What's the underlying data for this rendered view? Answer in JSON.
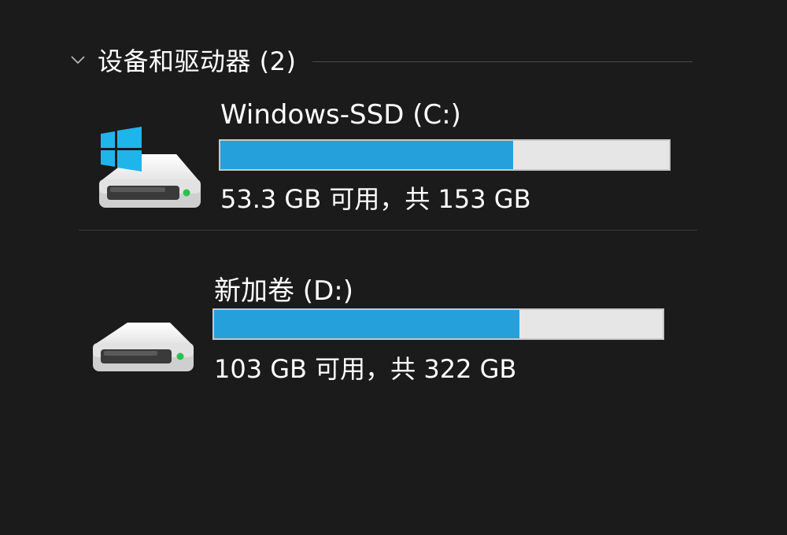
{
  "section": {
    "title": "设备和驱动器 (2)",
    "chevron_icon": "chevron-down-icon"
  },
  "drives": [
    {
      "name": "Windows-SSD (C:)",
      "capacity_text": "53.3 GB 可用，共 153 GB",
      "used_fraction": 0.652,
      "icon": "windows-drive-icon"
    },
    {
      "name": "新加卷 (D:)",
      "capacity_text": "103 GB 可用，共 322 GB",
      "used_fraction": 0.68,
      "icon": "hard-drive-icon"
    }
  ],
  "colors": {
    "background": "#1b1b1b",
    "bar_fill": "#26a0da",
    "bar_track": "#e6e6e6",
    "windows_logo": "#1fb5ea",
    "activity_led": "#27c24c"
  }
}
